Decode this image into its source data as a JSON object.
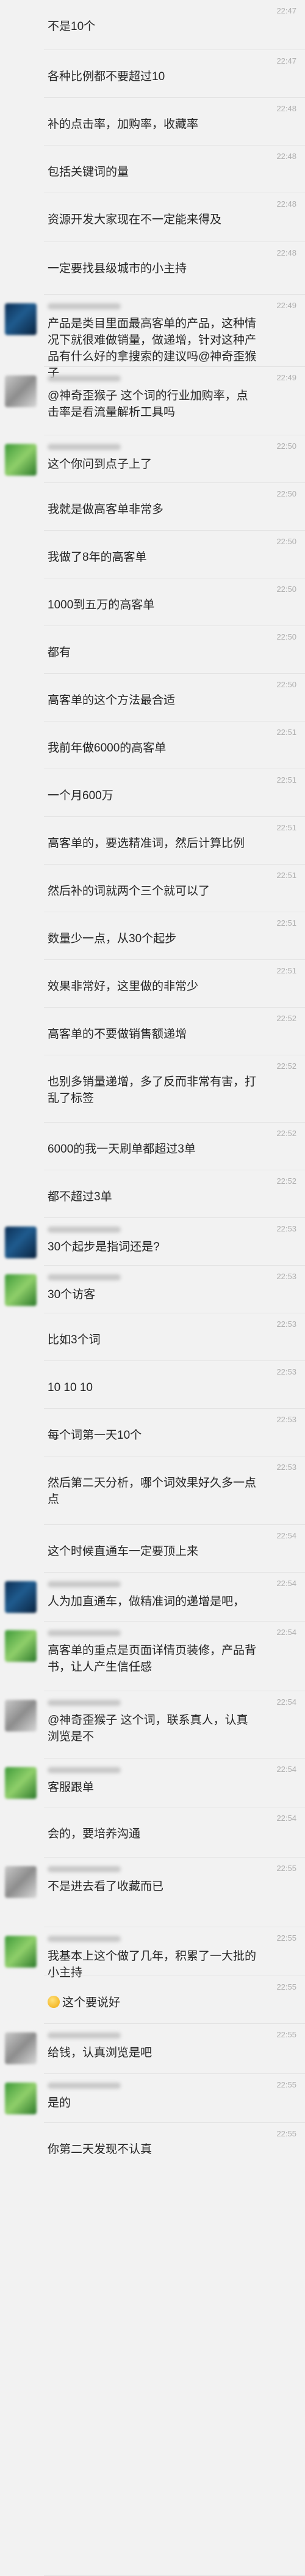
{
  "messages": [
    {
      "avatar": "",
      "time": "22:47",
      "text": "不是10个"
    },
    {
      "avatar": "",
      "time": "22:47",
      "text": "各种比例都不要超过10"
    },
    {
      "avatar": "",
      "time": "22:48",
      "text": "补的点击率，加购率，收藏率"
    },
    {
      "avatar": "",
      "time": "22:48",
      "text": "包括关键词的量"
    },
    {
      "avatar": "",
      "time": "22:48",
      "text": "资源开发大家现在不一定能来得及"
    },
    {
      "avatar": "",
      "time": "22:48",
      "text": "一定要找县级城市的小主持"
    },
    {
      "avatar": "blue",
      "time": "22:49",
      "text": "产品是类目里面最高客单的产品，这种情况下就很难做销量，做递增，针对这种产品有什么好的拿搜索的建议吗@神奇歪猴子"
    },
    {
      "avatar": "gray",
      "time": "22:49",
      "text": "@神奇歪猴子 这个词的行业加购率，点击率是看流量解析工具吗"
    },
    {
      "avatar": "green",
      "time": "22:50",
      "text": "这个你问到点子上了"
    },
    {
      "avatar": "",
      "time": "22:50",
      "text": "我就是做高客单非常多"
    },
    {
      "avatar": "",
      "time": "22:50",
      "text": "我做了8年的高客单"
    },
    {
      "avatar": "",
      "time": "22:50",
      "text": "1000到五万的高客单"
    },
    {
      "avatar": "",
      "time": "22:50",
      "text": "都有"
    },
    {
      "avatar": "",
      "time": "22:50",
      "text": "高客单的这个方法最合适"
    },
    {
      "avatar": "",
      "time": "22:51",
      "text": "我前年做6000的高客单"
    },
    {
      "avatar": "",
      "time": "22:51",
      "text": "一个月600万"
    },
    {
      "avatar": "",
      "time": "22:51",
      "text": "高客单的，要选精准词，然后计算比例"
    },
    {
      "avatar": "",
      "time": "22:51",
      "text": "然后补的词就两个三个就可以了"
    },
    {
      "avatar": "",
      "time": "22:51",
      "text": "数量少一点，从30个起步"
    },
    {
      "avatar": "",
      "time": "22:51",
      "text": "效果非常好，这里做的非常少"
    },
    {
      "avatar": "",
      "time": "22:52",
      "text": "高客单的不要做销售额递增"
    },
    {
      "avatar": "",
      "time": "22:52",
      "text": "也别多销量递增，多了反而非常有害，打乱了标签"
    },
    {
      "avatar": "",
      "time": "22:52",
      "text": "6000的我一天刷单都超过3单"
    },
    {
      "avatar": "",
      "time": "22:52",
      "text": "都不超过3单"
    },
    {
      "avatar": "blue",
      "time": "22:53",
      "text": "30个起步是指词还是?"
    },
    {
      "avatar": "green",
      "time": "22:53",
      "text": "30个访客"
    },
    {
      "avatar": "",
      "time": "22:53",
      "text": "比如3个词"
    },
    {
      "avatar": "",
      "time": "22:53",
      "text": "10  10 10"
    },
    {
      "avatar": "",
      "time": "22:53",
      "text": "每个词第一天10个"
    },
    {
      "avatar": "",
      "time": "22:53",
      "text": "然后第二天分析，哪个词效果好久多一点点"
    },
    {
      "avatar": "",
      "time": "22:54",
      "text": "这个时候直通车一定要顶上来"
    },
    {
      "avatar": "blue",
      "time": "22:54",
      "text": "人为加直通车，做精准词的递增是吧，"
    },
    {
      "avatar": "green",
      "time": "22:54",
      "text": "高客单的重点是页面详情页装修，产品背书，让人产生信任感"
    },
    {
      "avatar": "gray",
      "time": "22:54",
      "text": "@神奇歪猴子 这个词，联系真人，认真浏览是不"
    },
    {
      "avatar": "green",
      "time": "22:54",
      "text": "客服跟单"
    },
    {
      "avatar": "",
      "time": "22:54",
      "text": "会的，要培养沟通"
    },
    {
      "avatar": "gray",
      "time": "22:55",
      "text": "不是进去看了收藏而已"
    },
    {
      "avatar": "green",
      "time": "22:55",
      "text": "我基本上这个做了几年，积累了一大批的小主持"
    },
    {
      "avatar": "",
      "time": "22:55",
      "text": "这个要说好",
      "emoji": "smile-emoji"
    },
    {
      "avatar": "gray",
      "time": "22:55",
      "text": "给钱，认真浏览是吧"
    },
    {
      "avatar": "green",
      "time": "22:55",
      "text": "是的"
    },
    {
      "avatar": "",
      "time": "22:55",
      "text": "你第二天发现不认真"
    }
  ]
}
